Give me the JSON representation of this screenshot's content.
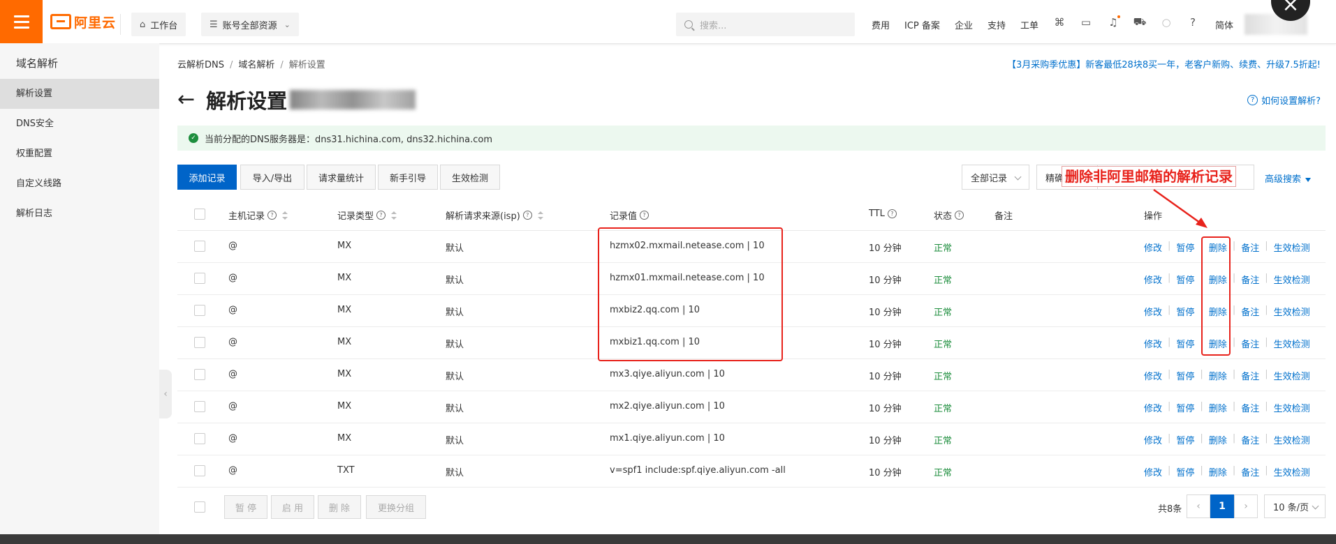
{
  "topbar": {
    "logo_text": "阿里云",
    "workbench": "工作台",
    "account_resources": "账号全部资源",
    "search_placeholder": "搜索...",
    "nav": [
      "费用",
      "ICP 备案",
      "企业",
      "支持",
      "工单"
    ],
    "lang": "简体",
    "close_symbol": "×"
  },
  "sidebar": {
    "title": "域名解析",
    "items": [
      {
        "label": "解析设置",
        "active": true
      },
      {
        "label": "DNS安全",
        "active": false
      },
      {
        "label": "权重配置",
        "active": false
      },
      {
        "label": "自定义线路",
        "active": false
      },
      {
        "label": "解析日志",
        "active": false
      }
    ]
  },
  "breadcrumb": [
    "云解析DNS",
    "域名解析",
    "解析设置"
  ],
  "promo": "【3月采购季优惠】新客最低28块8买一年，老客户新购、续费、升级7.5折起!",
  "page_title": "解析设置",
  "help_link": "如何设置解析?",
  "notice": "当前分配的DNS服务器是：dns31.hichina.com, dns32.hichina.com",
  "toolbar": {
    "add": "添加记录",
    "import_export": "导入/导出",
    "stats": "请求量统计",
    "guide": "新手引导",
    "check": "生效检测",
    "filter": "全部记录",
    "exact": "精确搜索",
    "advanced": "高级搜索"
  },
  "annotation": "删除非阿里邮箱的解析记录",
  "table": {
    "headers": {
      "host": "主机记录",
      "type": "记录类型",
      "isp": "解析请求来源(isp)",
      "value": "记录值",
      "ttl": "TTL",
      "status": "状态",
      "remark": "备注",
      "ops": "操作"
    },
    "ops_labels": [
      "修改",
      "暂停",
      "删除",
      "备注",
      "生效检测"
    ],
    "rows": [
      {
        "host": "@",
        "type": "MX",
        "isp": "默认",
        "value": "hzmx02.mxmail.netease.com | 10",
        "ttl": "10 分钟",
        "status": "正常"
      },
      {
        "host": "@",
        "type": "MX",
        "isp": "默认",
        "value": "hzmx01.mxmail.netease.com | 10",
        "ttl": "10 分钟",
        "status": "正常"
      },
      {
        "host": "@",
        "type": "MX",
        "isp": "默认",
        "value": "mxbiz2.qq.com | 10",
        "ttl": "10 分钟",
        "status": "正常"
      },
      {
        "host": "@",
        "type": "MX",
        "isp": "默认",
        "value": "mxbiz1.qq.com | 10",
        "ttl": "10 分钟",
        "status": "正常"
      },
      {
        "host": "@",
        "type": "MX",
        "isp": "默认",
        "value": "mx3.qiye.aliyun.com | 10",
        "ttl": "10 分钟",
        "status": "正常"
      },
      {
        "host": "@",
        "type": "MX",
        "isp": "默认",
        "value": "mx2.qiye.aliyun.com | 10",
        "ttl": "10 分钟",
        "status": "正常"
      },
      {
        "host": "@",
        "type": "MX",
        "isp": "默认",
        "value": "mx1.qiye.aliyun.com | 10",
        "ttl": "10 分钟",
        "status": "正常"
      },
      {
        "host": "@",
        "type": "TXT",
        "isp": "默认",
        "value": "v=spf1 include:spf.qiye.aliyun.com -all",
        "ttl": "10 分钟",
        "status": "正常"
      }
    ]
  },
  "footer": {
    "pause": "暂 停",
    "enable": "启 用",
    "delete": "删 除",
    "change_group": "更换分组",
    "total": "共8条",
    "current_page": "1",
    "page_size": "10 条/页"
  },
  "colors": {
    "brand": "#ff6a00",
    "primary": "#0064c8",
    "link": "#0070cc",
    "status_ok": "#1e8e3e",
    "annotation": "#e8221b"
  }
}
